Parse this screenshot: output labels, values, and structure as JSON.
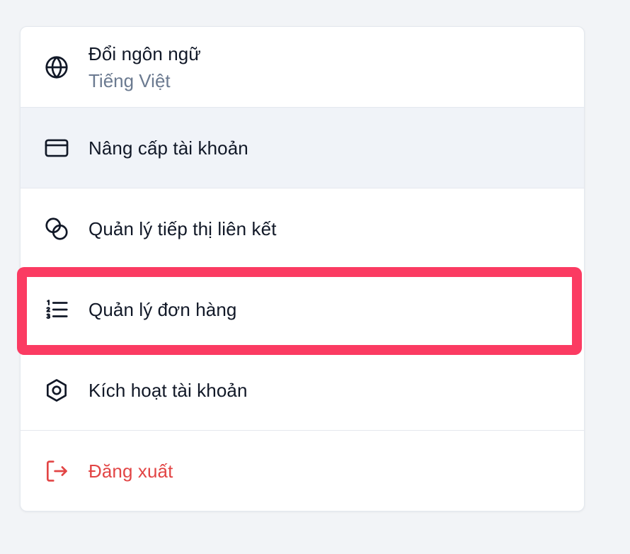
{
  "menu": {
    "items": [
      {
        "label": "Đổi ngôn ngữ",
        "sublabel": "Tiếng Việt",
        "icon": "globe-icon"
      },
      {
        "label": "Nâng cấp tài khoản",
        "icon": "credit-card-icon"
      },
      {
        "label": "Quản lý tiếp thị liên kết",
        "icon": "overlapping-circles-icon"
      },
      {
        "label": "Quản lý đơn hàng",
        "icon": "numbered-list-icon"
      },
      {
        "label": "Kích hoạt tài khoản",
        "icon": "hexagon-nut-icon"
      },
      {
        "label": "Đăng xuất",
        "icon": "logout-icon"
      }
    ]
  },
  "colors": {
    "focus_ring": "#fb3b62",
    "danger": "#e24545",
    "hover_bg": "#f0f3f8",
    "text": "#111827",
    "muted": "#6b7a90"
  }
}
